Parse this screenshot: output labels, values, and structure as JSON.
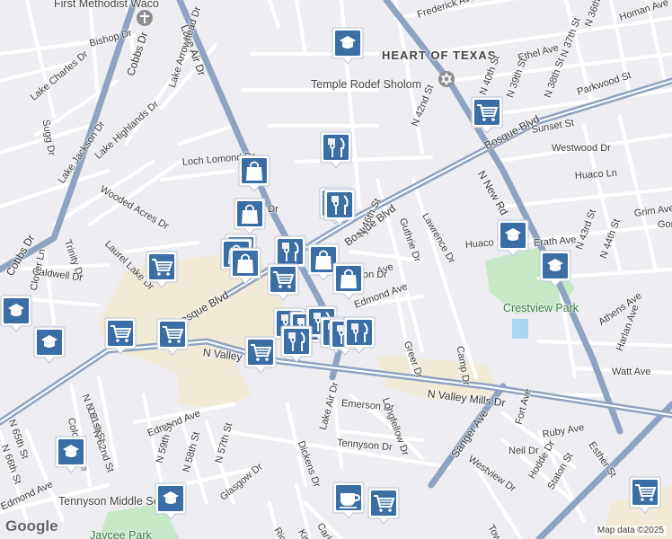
{
  "map": {
    "attribution": "Map data ©2025",
    "logo": "Google"
  },
  "colors": {
    "background": "#eeedf2",
    "minor_road": "#ffffff",
    "major_road": "#8fa3c0",
    "commercial": "#f1ead6",
    "park": "#c6e8c7",
    "water": "#a9d5f1",
    "pin": "#3a6ea5"
  },
  "labels": [
    {
      "text": "First Methodist Waco",
      "kind": "poi"
    },
    {
      "text": "Bishop Dr"
    },
    {
      "text": "Lake Air Dr",
      "kind": "major"
    },
    {
      "text": "Cobbs Dr",
      "kind": "major"
    },
    {
      "text": "Lake Arrowhead Dr"
    },
    {
      "text": "Lake Charles Dr"
    },
    {
      "text": "Lake Highlands Dr"
    },
    {
      "text": "Sugg Dr"
    },
    {
      "text": "Loch Lomond Dr"
    },
    {
      "text": "Lake Jackson Dr"
    },
    {
      "text": "Wooded Acres Dr"
    },
    {
      "text": "Laurel Lake Dr"
    },
    {
      "text": "Trinity Dr"
    },
    {
      "text": "Caldwell Dr"
    },
    {
      "text": "Clover Ln"
    },
    {
      "text": "Cobbs Dr",
      "kind": "major"
    },
    {
      "text": "Bosque Blvd",
      "kind": "major"
    },
    {
      "text": "Bosque Blvd",
      "kind": "major"
    },
    {
      "text": "Bosque Blvd",
      "kind": "major"
    },
    {
      "text": "HEART OF TEXAS",
      "kind": "big"
    },
    {
      "text": "Temple Rodef Sholom",
      "kind": "poi"
    },
    {
      "text": "Frederick Ave"
    },
    {
      "text": "Ethel Ave"
    },
    {
      "text": "N 36th St"
    },
    {
      "text": "N 37th St"
    },
    {
      "text": "Homan Ave"
    },
    {
      "text": "N 40th St"
    },
    {
      "text": "N 39th St"
    },
    {
      "text": "N 38th St"
    },
    {
      "text": "Parkwood St"
    },
    {
      "text": "Sunset St"
    },
    {
      "text": "N 42nd St"
    },
    {
      "text": "N New Rd",
      "kind": "major"
    },
    {
      "text": "Westwood Dr"
    },
    {
      "text": "Huaco Ln"
    },
    {
      "text": "Grim Ave"
    },
    {
      "text": "Gorm"
    },
    {
      "text": "N 46th St"
    },
    {
      "text": "Guthrie Dr"
    },
    {
      "text": "Lawrence Dr"
    },
    {
      "text": "Huaco Ln"
    },
    {
      "text": "Erath Ave"
    },
    {
      "text": "N 43rd St"
    },
    {
      "text": "N 44th St"
    },
    {
      "text": "Crestview Park",
      "kind": "park"
    },
    {
      "text": "Athens Ave"
    },
    {
      "text": "Harlan Ave"
    },
    {
      "text": "Watt Ave"
    },
    {
      "text": "Edmond Ave"
    },
    {
      "text": "Ave"
    },
    {
      "text": "Greer Dr"
    },
    {
      "text": "Camp Dr"
    },
    {
      "text": "N Valley Mills Dr",
      "kind": "major"
    },
    {
      "text": "N Valley",
      "kind": "major"
    },
    {
      "text": "Lake Air Dr"
    },
    {
      "text": "Emerson Dr"
    },
    {
      "text": "Longfellow Dr"
    },
    {
      "text": "Tennyson Dr"
    },
    {
      "text": "Sanger Ave",
      "kind": "major"
    },
    {
      "text": "Fort Ave"
    },
    {
      "text": "Ruby Ave"
    },
    {
      "text": "Esther St"
    },
    {
      "text": "Neil Dr"
    },
    {
      "text": "Hodde Dr"
    },
    {
      "text": "Westview Dr"
    },
    {
      "text": "Staton St"
    },
    {
      "text": "Towne"
    },
    {
      "text": "N 60th St"
    },
    {
      "text": "N 61st St"
    },
    {
      "text": "Colonial Ave"
    },
    {
      "text": "N 62nd St"
    },
    {
      "text": "Edmond Ave"
    },
    {
      "text": "N 59th St"
    },
    {
      "text": "N 57th St"
    },
    {
      "text": "N 58th St"
    },
    {
      "text": "N 65th St"
    },
    {
      "text": "N 66th St"
    },
    {
      "text": "Glasgow Dr"
    },
    {
      "text": "Dickens Dr"
    },
    {
      "text": "Kiplin"
    },
    {
      "text": "Carlyle"
    },
    {
      "text": "Rich"
    },
    {
      "text": "Tennyson Middle School",
      "kind": "poi"
    },
    {
      "text": "Edmond Ave"
    },
    {
      "text": "Jaycee Park",
      "kind": "park"
    },
    {
      "text": "dd Dr"
    },
    {
      "text": "on Dr"
    }
  ],
  "markers": [
    {
      "icon": "school-icon"
    },
    {
      "icon": "cart-icon"
    },
    {
      "icon": "school-icon"
    },
    {
      "icon": "restaurant-icon"
    },
    {
      "icon": "shopping-bag-icon"
    },
    {
      "icon": "restaurant-icon"
    },
    {
      "icon": "restaurant-icon"
    },
    {
      "icon": "shopping-bag-icon"
    },
    {
      "icon": "shopping-bag-icon"
    },
    {
      "icon": "shopping-bag-icon"
    },
    {
      "icon": "shopping-bag-icon"
    },
    {
      "icon": "restaurant-icon"
    },
    {
      "icon": "shopping-bag-icon"
    },
    {
      "icon": "shopping-bag-icon"
    },
    {
      "icon": "cart-icon"
    },
    {
      "icon": "cart-icon"
    },
    {
      "icon": "school-icon"
    },
    {
      "icon": "school-icon"
    },
    {
      "icon": "school-icon"
    },
    {
      "icon": "cart-icon"
    },
    {
      "icon": "cart-icon"
    },
    {
      "icon": "cart-icon"
    },
    {
      "icon": "restaurant-icon"
    },
    {
      "icon": "restaurant-icon"
    },
    {
      "icon": "restaurant-icon"
    },
    {
      "icon": "restaurant-icon"
    },
    {
      "icon": "restaurant-icon"
    },
    {
      "icon": "restaurant-icon"
    },
    {
      "icon": "restaurant-icon"
    },
    {
      "icon": "school-icon"
    },
    {
      "icon": "school-icon"
    },
    {
      "icon": "coffee-icon"
    },
    {
      "icon": "cart-icon"
    },
    {
      "icon": "cart-icon"
    }
  ]
}
